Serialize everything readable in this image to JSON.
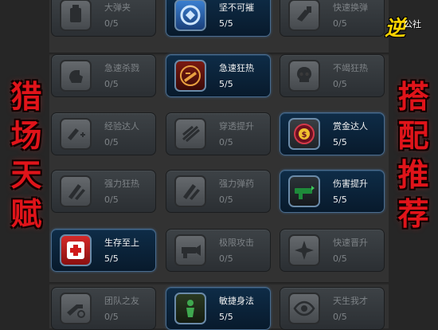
{
  "logo": {
    "mark": "逆",
    "text": "公社"
  },
  "left_banner": [
    "猎",
    "场",
    "天",
    "赋"
  ],
  "right_banner": [
    "搭",
    "配",
    "推",
    "荐"
  ],
  "colors": {
    "title_red": "#e0141a",
    "active_border": "#4a6c8e",
    "logo_yellow": "#ffd400"
  },
  "rows": [
    [
      {
        "name": "大弹夹",
        "count": "0/5",
        "icon": "magazine-icon",
        "active": false
      },
      {
        "name": "坚不可摧",
        "count": "5/5",
        "icon": "shield-burst-icon",
        "active": true
      },
      {
        "name": "快速换弹",
        "count": "0/5",
        "icon": "reload-icon",
        "active": false
      }
    ],
    [
      {
        "name": "急速杀戮",
        "count": "0/5",
        "icon": "fist-icon",
        "active": false
      },
      {
        "name": "急速狂热",
        "count": "5/5",
        "icon": "frenzy-icon",
        "active": true
      },
      {
        "name": "不竭狂热",
        "count": "0/5",
        "icon": "skull-icon",
        "active": false
      }
    ],
    [
      {
        "name": "经验达人",
        "count": "0/5",
        "icon": "exp-plus-icon",
        "active": false
      },
      {
        "name": "穿透提升",
        "count": "0/5",
        "icon": "penetration-icon",
        "active": false
      },
      {
        "name": "赏金达人",
        "count": "5/5",
        "icon": "bounty-icon",
        "active": true
      }
    ],
    [
      {
        "name": "强力狂热",
        "count": "0/5",
        "icon": "power-frenzy-icon",
        "active": false
      },
      {
        "name": "强力弹药",
        "count": "0/5",
        "icon": "power-ammo-icon",
        "active": false
      },
      {
        "name": "伤害提升",
        "count": "5/5",
        "icon": "damage-gun-icon",
        "active": true
      }
    ],
    [
      {
        "name": "生存至上",
        "count": "5/5",
        "icon": "medkit-icon",
        "active": true
      },
      {
        "name": "极限攻击",
        "count": "0/5",
        "icon": "extreme-attack-icon",
        "active": false
      },
      {
        "name": "快速晋升",
        "count": "0/5",
        "icon": "promotion-icon",
        "active": false
      }
    ],
    [
      {
        "name": "团队之友",
        "count": "0/5",
        "icon": "team-gun-icon",
        "active": false
      },
      {
        "name": "敏捷身法",
        "count": "5/5",
        "icon": "agility-icon",
        "active": true
      },
      {
        "name": "天生我才",
        "count": "0/5",
        "icon": "eye-icon",
        "active": false
      }
    ]
  ]
}
